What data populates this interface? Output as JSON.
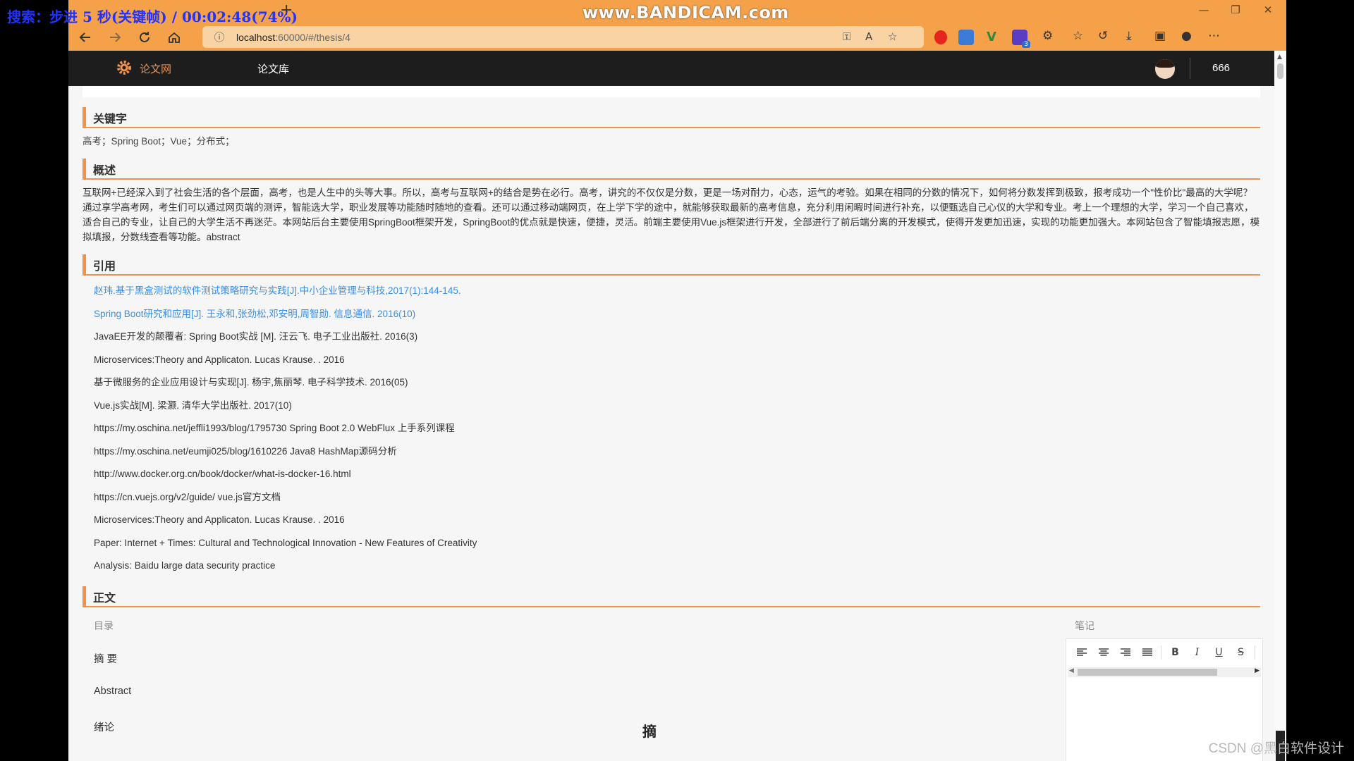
{
  "overlay": {
    "recorder_status": "搜索：步进 5 秒(关键帧) / 00:02:48(74%)",
    "watermark": "www.BANDICAM.com",
    "csdn_credit": "CSDN @黑白软件设计"
  },
  "browser": {
    "url_host": "localhost",
    "url_rest": ":60000/#/thesis/4",
    "new_tab_symbol": "+",
    "window_controls": {
      "minimize": "—",
      "maximize": "❐",
      "close": "✕"
    },
    "nav_icons": [
      "back-arrow-icon",
      "forward-arrow-icon",
      "reload-icon",
      "home-icon"
    ],
    "extension_colors": {
      "red": "#e8241f",
      "green": "#2d8a3e",
      "purple": "#5b3cc4",
      "blue": "#2a6fd6"
    },
    "extension_badge": "3"
  },
  "site": {
    "logo_text": "论文网",
    "nav_library": "论文库",
    "username": "666",
    "accent_color": "#f2914a"
  },
  "thesis": {
    "keywords_heading": "关键字",
    "keywords": "高考；Spring Boot；Vue；分布式；",
    "summary_heading": "概述",
    "summary": "互联网+已经深入到了社会生活的各个层面，高考，也是人生中的头等大事。所以，高考与互联网+的结合是势在必行。高考，讲究的不仅仅是分数，更是一场对耐力，心态，运气的考验。如果在相同的分数的情况下，如何将分数发挥到极致，报考成功一个\"性价比\"最高的大学呢？通过享学高考网，考生们可以通过网页端的测评，智能选大学，职业发展等功能随时随地的查看。还可以通过移动端网页，在上学下学的途中，就能够获取最新的高考信息，充分利用闲暇时间进行补充，以便甄选自己心仪的大学和专业。考上一个理想的大学，学习一个自己喜欢，适合自己的专业，让自己的大学生活不再迷茫。本网站后台主要使用SpringBoot框架开发，SpringBoot的优点就是快速，便捷，灵活。前端主要使用Vue.js框架进行开发，全部进行了前后端分离的开发模式，使得开发更加迅速，实现的功能更加强大。本网站包含了智能填报志愿，模拟填报，分数线查看等功能。abstract",
    "refs_heading": "引用",
    "references": [
      "赵玮.基于黑盒测试的软件测试策略研究与实践[J].中小企业管理与科技,2017(1):144-145.",
      "Spring Boot研究和应用[J]. 王永和,张劲松,邓安明,周智勋. 信息通信. 2016(10)",
      "JavaEE开发的颠覆者: Spring Boot实战 [M]. 汪云飞. 电子工业出版社. 2016(3)",
      "Microservices:Theory and Applicaton. Lucas Krause. . 2016",
      "基于微服务的企业应用设计与实现[J]. 杨宇,焦丽琴. 电子科学技术. 2016(05)",
      "Vue.js实战[M]. 梁灏. 清华大学出版社. 2017(10)",
      "https://my.oschina.net/jeffli1993/blog/1795730 Spring Boot 2.0 WebFlux 上手系列课程",
      "https://my.oschina.net/eumji025/blog/1610226 Java8 HashMap源码分析",
      "http://www.docker.org.cn/book/docker/what-is-docker-16.html",
      "https://cn.vuejs.org/v2/guide/ vue.js官方文档",
      "Microservices:Theory and Applicaton. Lucas Krause. . 2016",
      "Paper: Internet + Times: Cultural and Technological Innovation - New Features of Creativity",
      "Analysis: Baidu large data security practice"
    ],
    "body_heading": "正文",
    "toc_title": "目录",
    "toc": [
      "摘 要",
      "Abstract",
      "绪论"
    ],
    "notes_title": "笔记",
    "doc_heading": "摘"
  },
  "editor_tools": [
    "align-left-icon",
    "align-center-icon",
    "align-right-icon",
    "align-justify-icon",
    "bold-icon",
    "italic-icon",
    "underline-icon",
    "strikethrough-icon"
  ],
  "editor_tool_labels": {
    "bold": "B",
    "italic": "I",
    "underline": "U",
    "strike": "S"
  }
}
